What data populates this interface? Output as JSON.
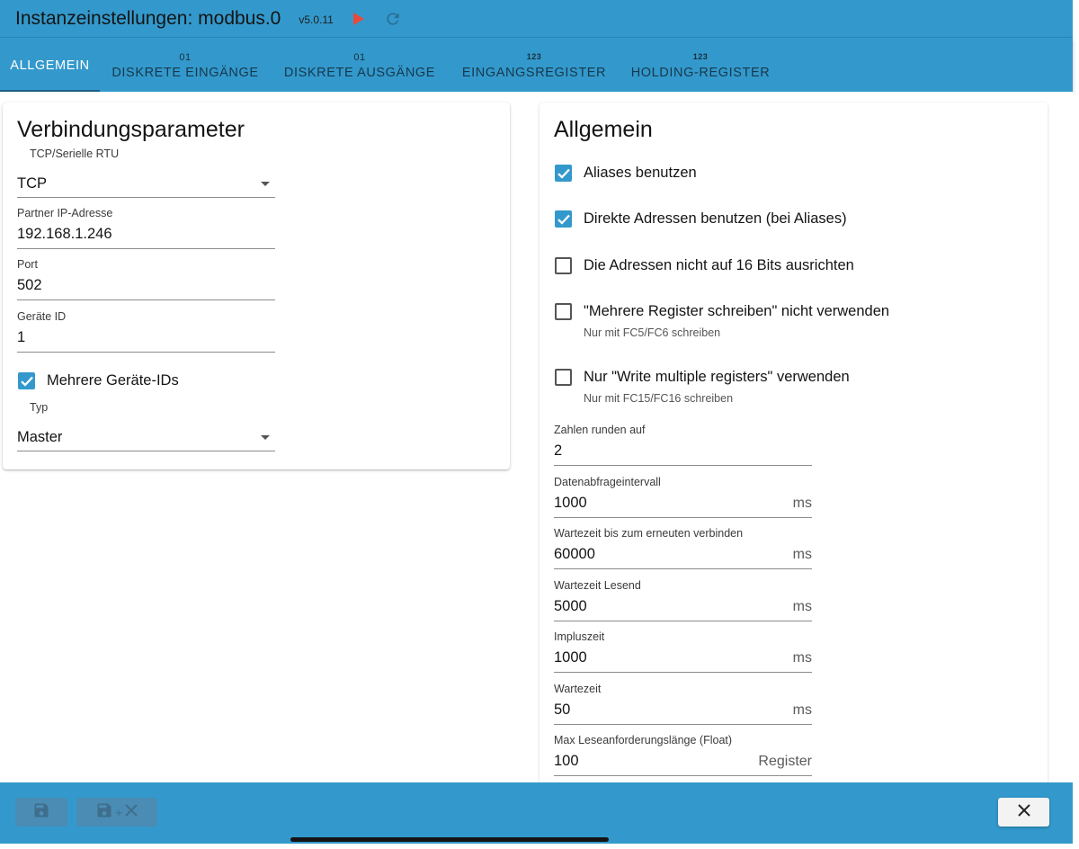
{
  "header": {
    "title": "Instanzeinstellungen: modbus.0",
    "version": "v5.0.11",
    "play_icon": "play-icon",
    "reload_icon": "reload-icon",
    "accent": "#3399cc",
    "play_color": "#e84a3a"
  },
  "tabs": [
    {
      "icon": "",
      "label": "ALLGEMEIN",
      "active": true
    },
    {
      "icon": "01",
      "label": "DISKRETE EINGÄNGE"
    },
    {
      "icon": "01",
      "label": "DISKRETE AUSGÄNGE"
    },
    {
      "icon": "123",
      "label": "EINGANGSREGISTER"
    },
    {
      "icon": "123",
      "label": "HOLDING-REGISTER"
    }
  ],
  "left": {
    "title": "Verbindungsparameter",
    "connection": {
      "label": "TCP/Serielle RTU",
      "value": "TCP"
    },
    "ip": {
      "label": "Partner IP-Adresse",
      "value": "192.168.1.246"
    },
    "port": {
      "label": "Port",
      "value": "502"
    },
    "device_id": {
      "label": "Geräte ID",
      "value": "1"
    },
    "multi_device": {
      "label": "Mehrere Geräte-IDs",
      "checked": true
    },
    "type": {
      "label": "Typ",
      "value": "Master"
    }
  },
  "right": {
    "title": "Allgemein",
    "checkboxes": [
      {
        "label": "Aliases benutzen",
        "checked": true
      },
      {
        "label": "Direkte Adressen benutzen (bei Aliases)",
        "checked": true
      },
      {
        "label": "Die Adressen nicht auf 16 Bits ausrichten",
        "checked": false
      },
      {
        "label": "\"Mehrere Register schreiben\" nicht verwenden",
        "checked": false,
        "hint": "Nur mit FC5/FC6 schreiben"
      },
      {
        "label": "Nur \"Write multiple registers\" verwenden",
        "checked": false,
        "hint": "Nur mit FC15/FC16 schreiben"
      }
    ],
    "fields": [
      {
        "label": "Zahlen runden auf",
        "value": "2",
        "unit": ""
      },
      {
        "label": "Datenabfrageintervall",
        "value": "1000",
        "unit": "ms"
      },
      {
        "label": "Wartezeit bis zum erneuten verbinden",
        "value": "60000",
        "unit": "ms"
      },
      {
        "label": "Wartezeit Lesend",
        "value": "5000",
        "unit": "ms"
      },
      {
        "label": "Impluszeit",
        "value": "1000",
        "unit": "ms"
      },
      {
        "label": "Wartezeit",
        "value": "50",
        "unit": "ms"
      },
      {
        "label": "Max Leseanforderungslänge (Float)",
        "value": "100",
        "unit": "Register"
      }
    ]
  },
  "footer": {
    "save_icon": "save-icon",
    "save_close_icon": "save-close-icon",
    "plus": "+",
    "close_icon": "close-icon"
  }
}
